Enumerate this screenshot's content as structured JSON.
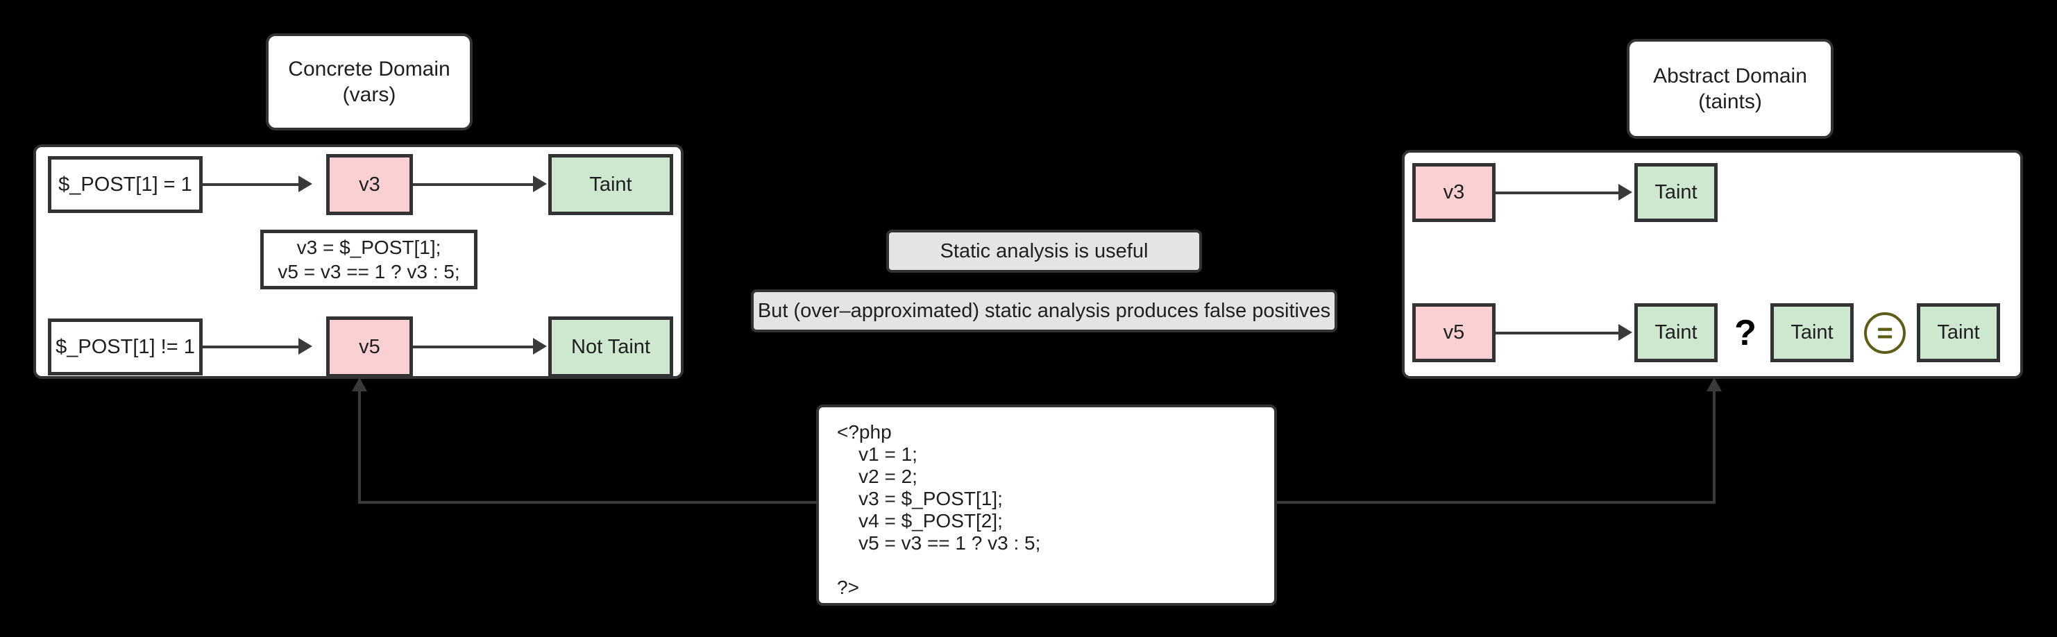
{
  "diagram": {
    "titles": {
      "concrete": "Concrete Domain\n(vars)",
      "abstract": "Abstract Domain\n(taints)"
    },
    "concrete_panel": {
      "row_top": {
        "condition": "$_POST[1] = 1",
        "variable": "v3",
        "result": "Taint"
      },
      "statement_box": "v3 = $_POST[1];\nv5 = v3 == 1 ? v3 : 5;",
      "row_bottom": {
        "condition": "$_POST[1] != 1",
        "variable": "v5",
        "result": "Not Taint"
      }
    },
    "abstract_panel": {
      "row_top": {
        "variable": "v3",
        "result": "Taint"
      },
      "row_bottom": {
        "variable": "v5",
        "result": "Taint",
        "question_mark": "?",
        "compare_left": "Taint",
        "equals_symbol": "=",
        "compare_right": "Taint"
      }
    },
    "callouts": [
      "Static analysis is useful",
      "But (over–approximated) static analysis produces false positives"
    ],
    "code_box": "<?php\n    v1 = 1;\n    v2 = 2;\n    v3 = $_POST[1];\n    v4 = $_POST[2];\n    v5 = v3 == 1 ? v3 : 5;\n\n?>"
  },
  "colors": {
    "background": "#000000",
    "node_stroke": "#333333",
    "tainted_var": "#fbd0d2",
    "taint_label": "#cde8ce",
    "callout": "#e4e4e4",
    "equals_ring": "#5e5c16",
    "edge": "#3a3a3a"
  }
}
